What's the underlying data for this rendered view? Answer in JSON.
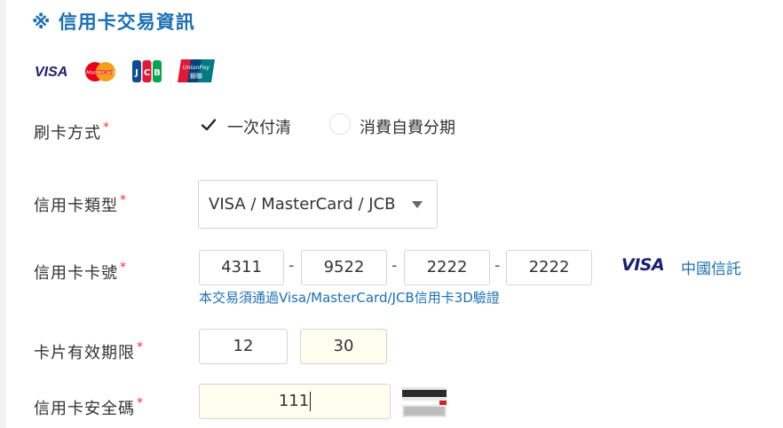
{
  "section": {
    "title": "※ 信用卡交易資訊"
  },
  "card_logos": [
    {
      "name": "visa",
      "text": "VISA"
    },
    {
      "name": "mastercard",
      "text": "MasterCard"
    },
    {
      "name": "jcb",
      "text": "JCB"
    },
    {
      "name": "unionpay",
      "text": "UnionPay 銀聯"
    }
  ],
  "form": {
    "payment_method": {
      "label": "刷卡方式",
      "required_mark": "*",
      "options": [
        {
          "label": "一次付清",
          "checked": true
        },
        {
          "label": "消費自費分期",
          "checked": false
        }
      ]
    },
    "card_type": {
      "label": "信用卡類型",
      "required_mark": "*",
      "selected": "VISA / MasterCard / JCB"
    },
    "card_number": {
      "label": "信用卡卡號",
      "required_mark": "*",
      "segments": [
        "4311",
        "9522",
        "2222",
        "2222"
      ],
      "separator": "-",
      "brand": "VISA",
      "issuer": "中國信託",
      "note": "本交易須通過Visa/MasterCard/JCB信用卡3D驗證"
    },
    "expiry": {
      "label": "卡片有效期限",
      "required_mark": "*",
      "month": "12",
      "year": "30"
    },
    "cvv": {
      "label": "信用卡安全碼",
      "required_mark": "*",
      "value": "111"
    }
  },
  "colors": {
    "accent_blue": "#1b6fb5",
    "required_red": "#e53935",
    "field_yellow": "#fffdee"
  }
}
